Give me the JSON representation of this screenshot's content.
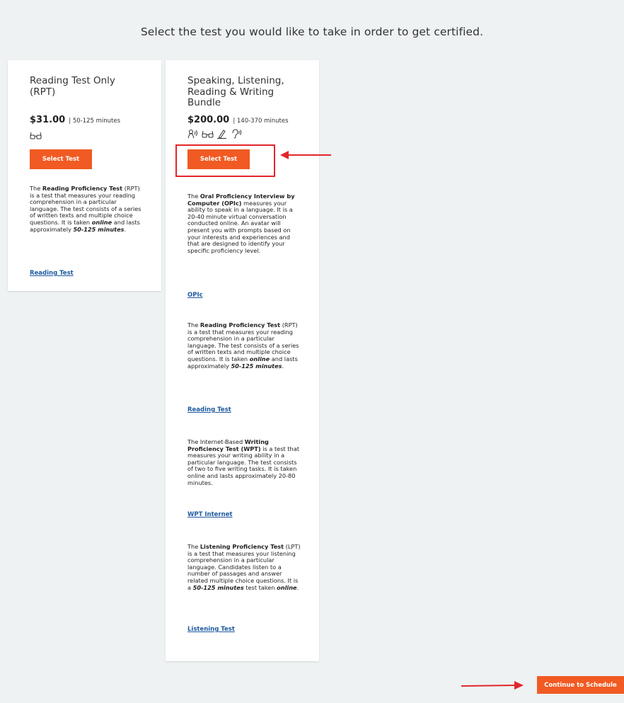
{
  "page": {
    "heading": "Select the test you would like to take in order to get certified."
  },
  "cards": [
    {
      "title": "Reading Test Only (RPT)",
      "price": "$31.00",
      "duration": "| 50-125 minutes",
      "icons": [
        "glasses-icon"
      ],
      "button_label": "Select Test",
      "sections": [
        {
          "desc_parts": [
            {
              "t": "The "
            },
            {
              "t": "Reading Proficiency Test",
              "b": true
            },
            {
              "t": " (RPT) is a test that measures your reading comprehension in a particular language. The test consists of a series of written texts and multiple choice questions. It is taken "
            },
            {
              "t": "online",
              "i": true
            },
            {
              "t": " and lasts approximately "
            },
            {
              "t": "50-125 minutes",
              "i": true
            },
            {
              "t": "."
            }
          ],
          "link": "Reading Test"
        }
      ]
    },
    {
      "title": "Speaking, Listening, Reading & Writing Bundle",
      "price": "$200.00",
      "duration": "| 140-370 minutes",
      "icons": [
        "speaking-icon",
        "glasses-icon",
        "pencil-icon",
        "listening-icon"
      ],
      "button_label": "Select Test",
      "sections": [
        {
          "desc_parts": [
            {
              "t": "The "
            },
            {
              "t": "Oral Proficiency Interview by Computer (OPIc)",
              "b": true
            },
            {
              "t": " measures your ability to speak in a language. It is a 20-40 minute virtual conversation conducted online. An avatar will present you with prompts based on your interests and experiences and that are designed to identify your specific proficiency level."
            }
          ],
          "link": "OPIc"
        },
        {
          "desc_parts": [
            {
              "t": "The "
            },
            {
              "t": "Reading Proficiency Test",
              "b": true
            },
            {
              "t": " (RPT) is a test that measures your reading comprehension in a particular language. The test consists of a series of written texts and multiple choice questions. It is taken "
            },
            {
              "t": "online",
              "i": true
            },
            {
              "t": " and lasts approximately "
            },
            {
              "t": "50-125 minutes",
              "i": true
            },
            {
              "t": "."
            }
          ],
          "link": "Reading Test"
        },
        {
          "desc_parts": [
            {
              "t": "The Internet-Based "
            },
            {
              "t": "Writing Proficiency Test (WPT)",
              "b": true
            },
            {
              "t": " is a test that measures your writing ability in a particular language. The test consists of two to five writing tasks. It is taken online and lasts approximately 20-80 minutes."
            }
          ],
          "link": "WPT Internet"
        },
        {
          "desc_parts": [
            {
              "t": "The "
            },
            {
              "t": "Listening Proficiency Test",
              "b": true
            },
            {
              "t": " (LPT) is a test that measures your listening comprehension in a particular language. Candidates listen to a number of passages and answer related multiple choice questions. It is a "
            },
            {
              "t": "50-125 minutes",
              "i": true
            },
            {
              "t": " test taken "
            },
            {
              "t": "online",
              "i": true
            },
            {
              "t": "."
            }
          ],
          "link": "Listening Test"
        }
      ]
    }
  ],
  "footer": {
    "continue_label": "Continue to Schedule"
  },
  "colors": {
    "accent": "#f15a22",
    "link": "#1e5aa0",
    "annotation": "#e3262b",
    "page_bg": "#eef2f3"
  }
}
